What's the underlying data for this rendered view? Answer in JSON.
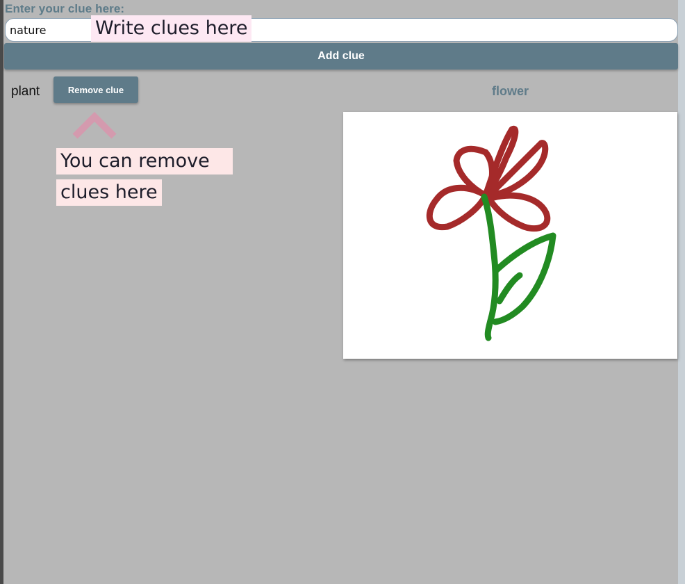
{
  "clue_form": {
    "label": "Enter your clue here:",
    "input_value": "nature",
    "add_button_label": "Add clue"
  },
  "tooltips": {
    "write_clues": "Write clues here",
    "remove_clues_line1": "You can remove",
    "remove_clues_line2": "clues here"
  },
  "clues": [
    {
      "text": "plant",
      "remove_label": "Remove clue"
    }
  ],
  "drawing": {
    "title": "flower",
    "icon": "flower-drawing",
    "colors": {
      "petals": "#a52a2a",
      "stem": "#228b22"
    }
  },
  "colors": {
    "accent": "#5f7b89",
    "background": "#b7b7b7",
    "tooltip_background": "#fde8f3"
  }
}
